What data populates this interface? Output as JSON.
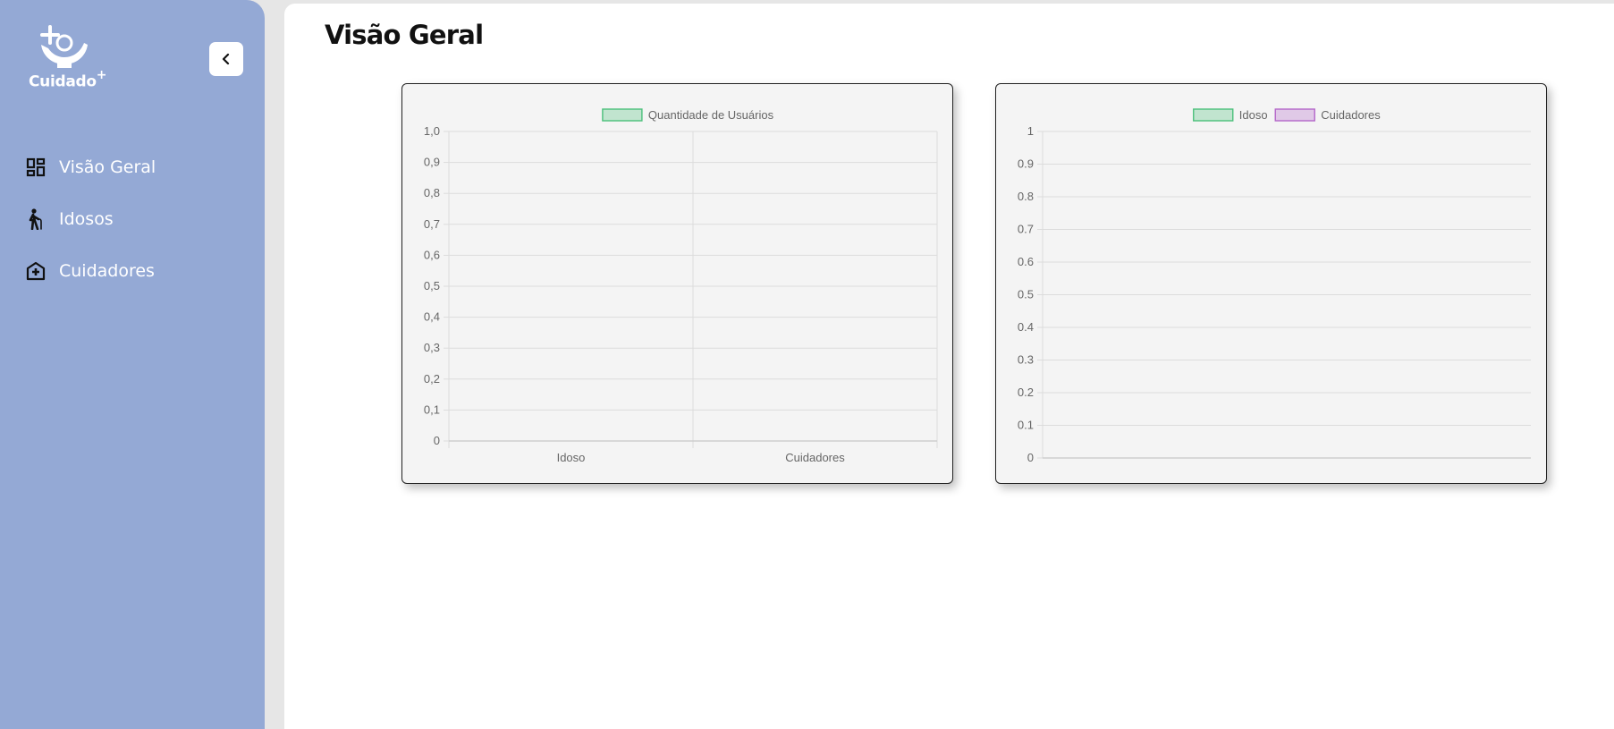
{
  "app": {
    "brand": "Cuidado",
    "brand_sup": "+",
    "collapse_icon": "chevron-left-icon"
  },
  "sidebar": {
    "items": [
      {
        "label": "Visão Geral",
        "icon": "dashboard-icon"
      },
      {
        "label": "Idosos",
        "icon": "elderly-walking-icon"
      },
      {
        "label": "Cuidadores",
        "icon": "home-health-icon"
      }
    ]
  },
  "main": {
    "title": "Visão Geral"
  },
  "chart_data": [
    {
      "type": "bar",
      "categories": [
        "Idoso",
        "Cuidadores"
      ],
      "series": [
        {
          "name": "Quantidade de Usuários",
          "values": [
            0,
            0
          ],
          "color": "#4bc07b"
        }
      ],
      "ylim": [
        0,
        1
      ],
      "yticks": [
        "0",
        "0,1",
        "0,2",
        "0,3",
        "0,4",
        "0,5",
        "0,6",
        "0,7",
        "0,8",
        "0,9",
        "1,0"
      ],
      "grid": true,
      "legend": "top"
    },
    {
      "type": "line",
      "categories": [],
      "series": [
        {
          "name": "Idoso",
          "values": [],
          "color": "#4bc07b"
        },
        {
          "name": "Cuidadores",
          "values": [],
          "color": "#b466c9"
        }
      ],
      "ylim": [
        0,
        1
      ],
      "yticks": [
        "0",
        "0.1",
        "0.2",
        "0.3",
        "0.4",
        "0.5",
        "0.6",
        "0.7",
        "0.8",
        "0.9",
        "1"
      ],
      "grid": true,
      "legend": "top"
    }
  ],
  "colors": {
    "sidebar": "#94a9d5",
    "card_bg": "#f4f4f4",
    "grid": "#dcdcdc",
    "tick_text": "#666666"
  }
}
